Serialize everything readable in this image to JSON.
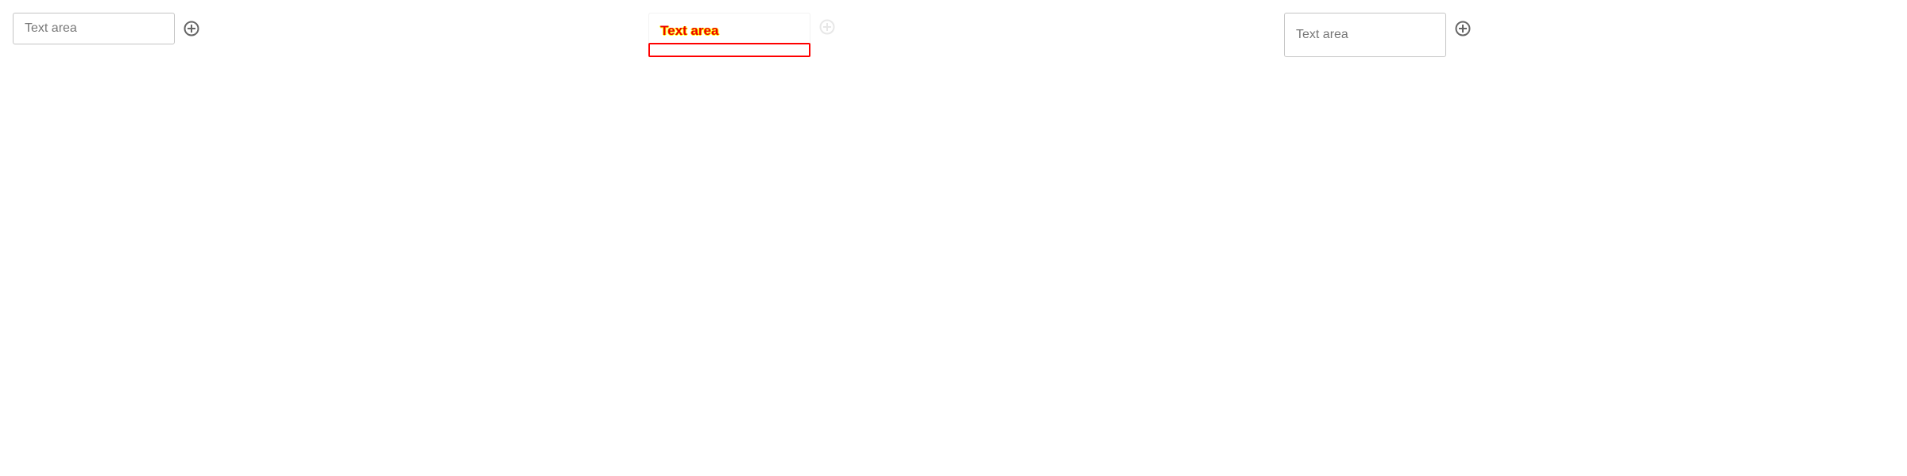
{
  "fields": [
    {
      "placeholder": "Text area",
      "icon": "plus-circle-icon"
    },
    {
      "placeholder": "Text area",
      "icon": "plus-circle-icon",
      "state": "highlighted"
    },
    {
      "placeholder": "Text area",
      "icon": "plus-circle-icon"
    }
  ],
  "colors": {
    "border": "#c4c4c4",
    "highlight": "#ff0000",
    "icon": "#666666"
  }
}
